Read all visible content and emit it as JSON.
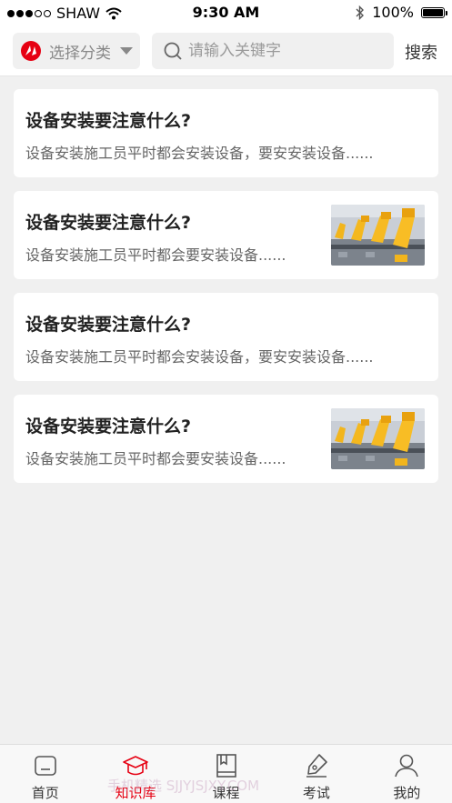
{
  "status_bar": {
    "carrier": "SHAW",
    "time": "9:30 AM",
    "battery": "100%",
    "battery_level": 1.0
  },
  "search_bar": {
    "category_label": "选择分类",
    "placeholder": "请输入关键字",
    "value": "",
    "search_label": "搜索"
  },
  "articles": [
    {
      "title": "设备安装要注意什么?",
      "summary": "设备安装施工员平时都会安装设备，要安安装设备......",
      "has_image": false
    },
    {
      "title": "设备安装要注意什么?",
      "summary": "设备安装施工员平时都会要安装设备......",
      "has_image": true
    },
    {
      "title": "设备安装要注意什么?",
      "summary": "设备安装施工员平时都会安装设备，要安安装设备......",
      "has_image": false
    },
    {
      "title": "设备安装要注意什么?",
      "summary": "设备安装施工员平时都会要安装设备......",
      "has_image": true
    }
  ],
  "tabbar": {
    "tabs": [
      {
        "label": "首页",
        "icon": "home-icon",
        "active": false
      },
      {
        "label": "知识库",
        "icon": "graduation-cap-icon",
        "active": true
      },
      {
        "label": "课程",
        "icon": "book-icon",
        "active": false
      },
      {
        "label": "考试",
        "icon": "pen-icon",
        "active": false
      },
      {
        "label": "我的",
        "icon": "user-icon",
        "active": false
      }
    ]
  },
  "watermark": "手机精选 SJJYJSJXY.COM",
  "colors": {
    "accent": "#e60012",
    "background": "#f0f0f0"
  }
}
